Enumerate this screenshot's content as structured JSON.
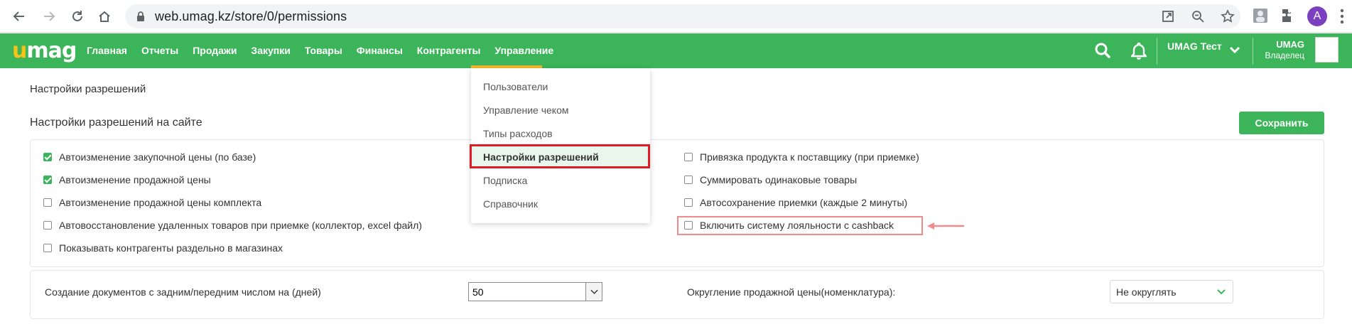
{
  "browser": {
    "url": "web.umag.kz/store/0/permissions",
    "profile_initial": "A"
  },
  "header": {
    "logo_u": "u",
    "logo_rest": "mag",
    "menu": [
      "Главная",
      "Отчеты",
      "Продажи",
      "Закупки",
      "Товары",
      "Финансы",
      "Контрагенты",
      "Управление"
    ],
    "active_menu": "Управление",
    "company": "UMAG Тест",
    "user_name": "UMAG",
    "user_role": "Владелец"
  },
  "dropdown": {
    "items": [
      "Пользователи",
      "Управление чеком",
      "Типы расходов",
      "Настройки разрешений",
      "Подписка",
      "Справочник"
    ],
    "active_item": "Настройки разрешений"
  },
  "page": {
    "title": "Настройки разрешений",
    "section_title": "Настройки разрешений на сайте",
    "save_label": "Сохранить"
  },
  "permissions_left": [
    {
      "label": "Автоизменение закупочной цены (по базе)",
      "checked": true
    },
    {
      "label": "Автоизменение продажной цены",
      "checked": true
    },
    {
      "label": "Автоизменение продажной цены комплекта",
      "checked": false
    },
    {
      "label": "Автовосстановление удаленных товаров при приемке (коллектор, excel файл)",
      "checked": false
    },
    {
      "label": "Показывать контрагенты раздельно в магазинах",
      "checked": false
    }
  ],
  "permissions_right": [
    {
      "label": "Привязка продукта к поставщику (при приемке)",
      "checked": false
    },
    {
      "label": "Суммировать одинаковые товары",
      "checked": false
    },
    {
      "label": "Автосохранение приемки (каждые 2 минуты)",
      "checked": false
    },
    {
      "label": "Включить систему лояльности с cashback",
      "checked": false
    }
  ],
  "settings": {
    "docs_label": "Создание документов с задним/передним числом на (дней)",
    "docs_value": "50",
    "rounding_label": "Округление продажной цены(номенклатура):",
    "rounding_value": "Не округлять"
  },
  "colors": {
    "brand_green": "#3cb55a",
    "accent_orange": "#f4b72b",
    "highlight_red": "#e01b24",
    "annotation_pink": "#f28b8b"
  }
}
